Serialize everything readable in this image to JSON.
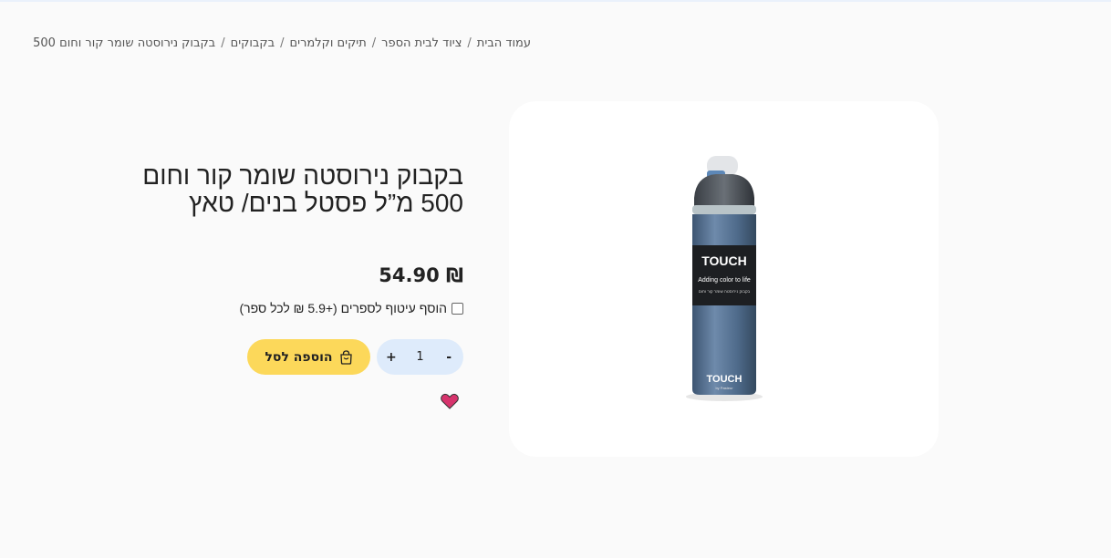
{
  "breadcrumb": {
    "items": [
      "עמוד הבית",
      "ציוד לבית הספר",
      "תיקים וקלמרים",
      "בקבוקים",
      "בקבוק נירוסטה שומר קור וחום 500"
    ],
    "separator": "/"
  },
  "product": {
    "title_line1": "בקבוק נירוסטה שומר קור וחום",
    "title_line2": "500 מ”ל פסטל בנים/ טאץ",
    "price": "₪ 54.90",
    "wrap_option_label": "הוסף עיטוף לספרים (+5.9 ₪ לכל ספר)",
    "image": {
      "brand": "TOUCH",
      "tagline": "Adding color to life",
      "by": "by Pasteur",
      "fine_print": "בקבוק נירוסטה שומר קור וחום"
    }
  },
  "quantity": {
    "minus": "-",
    "value": "1",
    "plus": "+"
  },
  "cart": {
    "add_label": "הוספה לסל"
  },
  "colors": {
    "background": "#fafafa",
    "qty_bg": "#deebfb",
    "cart_bg": "#fcd85a",
    "heart": "#d6336c",
    "bottle": "#4a6584"
  },
  "icons": [
    "bag-icon",
    "heart-icon"
  ]
}
